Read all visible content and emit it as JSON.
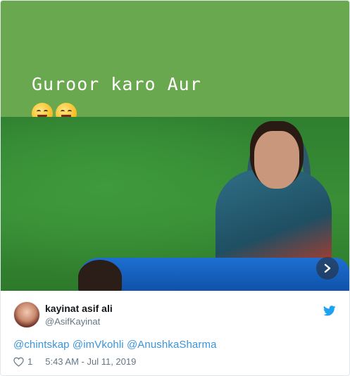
{
  "media": {
    "caption": "Guroor karo Aur",
    "emojis": [
      "face-savoring-food-icon",
      "grinning-squinting-face-icon"
    ]
  },
  "author": {
    "name": "kayinat asif ali",
    "handle": "@AsifKayinat"
  },
  "tweet": {
    "mentions": [
      "@chintskap",
      "@imVkohli",
      "@AnushkaSharma"
    ]
  },
  "footer": {
    "likes": "1",
    "timestamp": "5:43 AM - Jul 11, 2019"
  },
  "colors": {
    "link": "#3b94d9",
    "twitter_brand": "#1da1f2",
    "banner_green": "#6aa84f"
  }
}
